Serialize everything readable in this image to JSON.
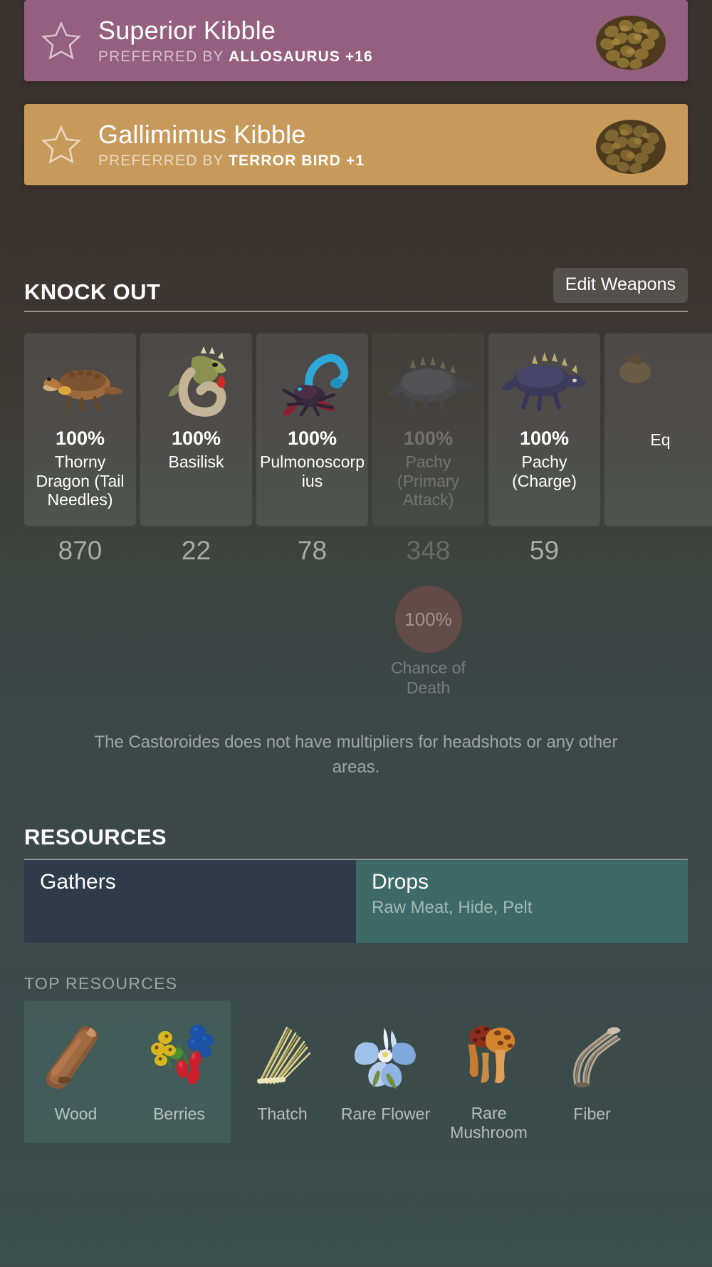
{
  "kibble": [
    {
      "title": "Superior Kibble",
      "preferred_prefix": "PREFERRED BY",
      "preferred_by": "ALLOSAURUS +16",
      "color": "#95607f",
      "icon": "kibble-icon",
      "star": "star-outline-icon"
    },
    {
      "title": "Gallimimus Kibble",
      "preferred_prefix": "PREFERRED BY",
      "preferred_by": "TERROR BIRD +1",
      "color": "#c79a5c",
      "icon": "kibble-icon",
      "star": "star-outline-icon"
    }
  ],
  "knockout": {
    "title": "KNOCK OUT",
    "edit_button": "Edit Weapons",
    "cards": [
      {
        "pct": "100%",
        "name": "Thorny Dragon (Tail Needles)",
        "count": "870",
        "dim": false,
        "icon": "thorny-dragon-icon"
      },
      {
        "pct": "100%",
        "name": "Basilisk",
        "count": "22",
        "dim": false,
        "icon": "basilisk-icon"
      },
      {
        "pct": "100%",
        "name": "Pulmonoscorpius",
        "count": "78",
        "dim": false,
        "icon": "pulmonoscorpius-icon"
      },
      {
        "pct": "100%",
        "name": "Pachy (Primary Attack)",
        "count": "348",
        "dim": true,
        "icon": "pachy-icon"
      },
      {
        "pct": "100%",
        "name": "Pachy (Charge)",
        "count": "59",
        "dim": false,
        "icon": "pachy-charge-icon"
      },
      {
        "pct": "",
        "name": "Eq",
        "count": "",
        "dim": false,
        "icon": "equus-icon"
      }
    ],
    "death": {
      "slot_index": 3,
      "value": "100%",
      "label": "Chance of Death",
      "color": "#be5a50"
    },
    "note": "The Castoroides does not have multipliers for headshots or any other areas."
  },
  "resources": {
    "title": "RESOURCES",
    "tabs": [
      {
        "label": "Gathers",
        "items": "",
        "color": "#2e3b4a",
        "active": false
      },
      {
        "label": "Drops",
        "items": "Raw Meat, Hide, Pelt",
        "color": "#3d6a67",
        "active": true
      }
    ],
    "top_resources_label": "TOP RESOURCES",
    "top_resources": [
      {
        "name": "Wood",
        "icon": "wood-log-icon",
        "highlight": true
      },
      {
        "name": "Berries",
        "icon": "berries-icon",
        "highlight": true
      },
      {
        "name": "Thatch",
        "icon": "thatch-icon",
        "highlight": false
      },
      {
        "name": "Rare Flower",
        "icon": "rare-flower-icon",
        "highlight": false
      },
      {
        "name": "Rare Mushroom",
        "icon": "rare-mushroom-icon",
        "highlight": false
      },
      {
        "name": "Fiber",
        "icon": "fiber-icon",
        "highlight": false
      }
    ]
  }
}
